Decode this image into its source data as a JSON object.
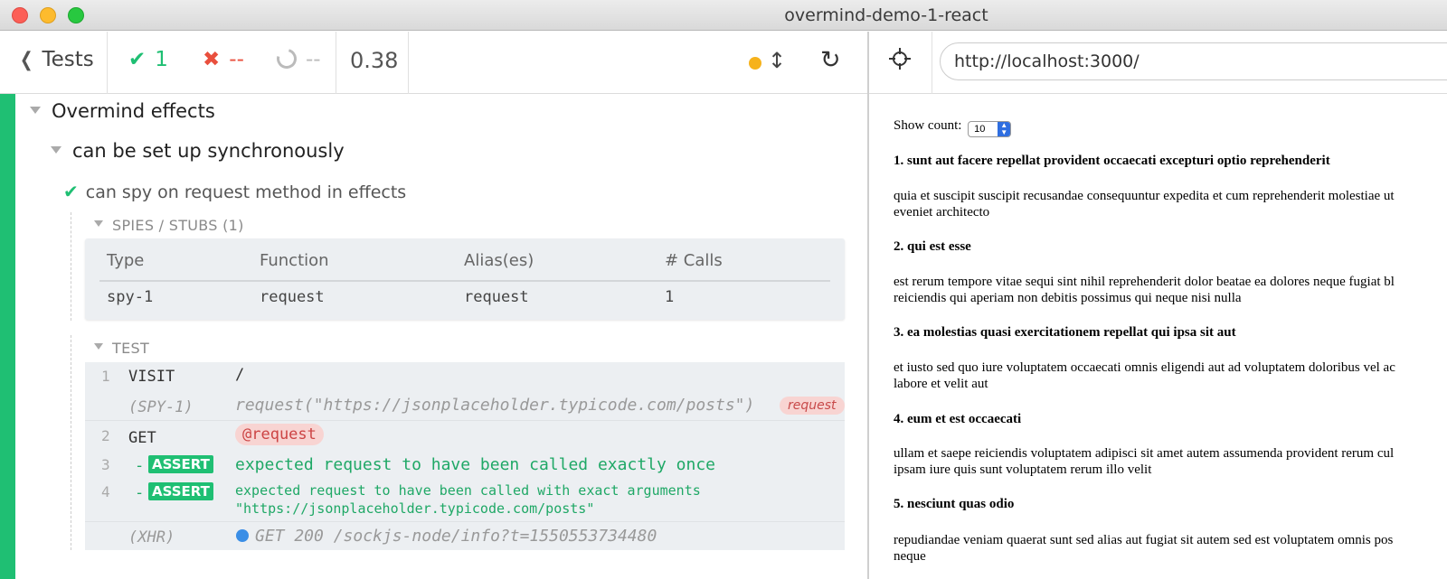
{
  "window": {
    "title": "overmind-demo-1-react"
  },
  "header": {
    "tests_label": "Tests",
    "passed": "1",
    "failed": "--",
    "pending": "--",
    "duration": "0.38"
  },
  "reporter": {
    "suite": "Overmind effects",
    "subsuite": "can be set up synchronously",
    "test": "can spy on request method in effects",
    "spies": {
      "title": "SPIES / STUBS (1)",
      "columns": [
        "Type",
        "Function",
        "Alias(es)",
        "# Calls"
      ],
      "row": [
        "spy-1",
        "request",
        "request",
        "1"
      ]
    },
    "test_section_title": "TEST",
    "commands": {
      "c1_num": "1",
      "c1_name": "VISIT",
      "c1_msg": "/",
      "spy_name": "(SPY-1)",
      "spy_msg": "request(\"https://jsonplaceholder.typicode.com/posts\")",
      "spy_alias": "request",
      "c2_num": "2",
      "c2_name": "GET",
      "c2_msg": "@request",
      "c3_num": "3",
      "c3_prefix": "-",
      "c3_badge": "ASSERT",
      "c3_msg": "expected request to have been called exactly once",
      "c4_num": "4",
      "c4_prefix": "-",
      "c4_badge": "ASSERT",
      "c4_msg_line1": "expected request to have been called with exact arguments",
      "c4_msg_line2": "\"https://jsonplaceholder.typicode.com/posts\"",
      "xhr_name": "(XHR)",
      "xhr_msg": "GET 200 /sockjs-node/info?t=1550553734480"
    }
  },
  "browser": {
    "url": "http://localhost:3000/"
  },
  "app": {
    "show_count_label": "Show count:",
    "show_count_value": "10",
    "posts": [
      {
        "title": "1. sunt aut facere repellat provident occaecati excepturi optio reprehenderit",
        "body1": "quia et suscipit suscipit recusandae consequuntur expedita et cum reprehenderit molestiae ut",
        "body2": "eveniet architecto"
      },
      {
        "title": "2. qui est esse",
        "body1": "est rerum tempore vitae sequi sint nihil reprehenderit dolor beatae ea dolores neque fugiat bl",
        "body2": "reiciendis qui aperiam non debitis possimus qui neque nisi nulla"
      },
      {
        "title": "3. ea molestias quasi exercitationem repellat qui ipsa sit aut",
        "body1": "et iusto sed quo iure voluptatem occaecati omnis eligendi aut ad voluptatem doloribus vel ac",
        "body2": "labore et velit aut"
      },
      {
        "title": "4. eum et est occaecati",
        "body1": "ullam et saepe reiciendis voluptatem adipisci sit amet autem assumenda provident rerum cul",
        "body2": "ipsam iure quis sunt voluptatem rerum illo velit"
      },
      {
        "title": "5. nesciunt quas odio",
        "body1": "repudiandae veniam quaerat sunt sed alias aut fugiat sit autem sed est voluptatem omnis pos",
        "body2": "neque"
      }
    ]
  }
}
